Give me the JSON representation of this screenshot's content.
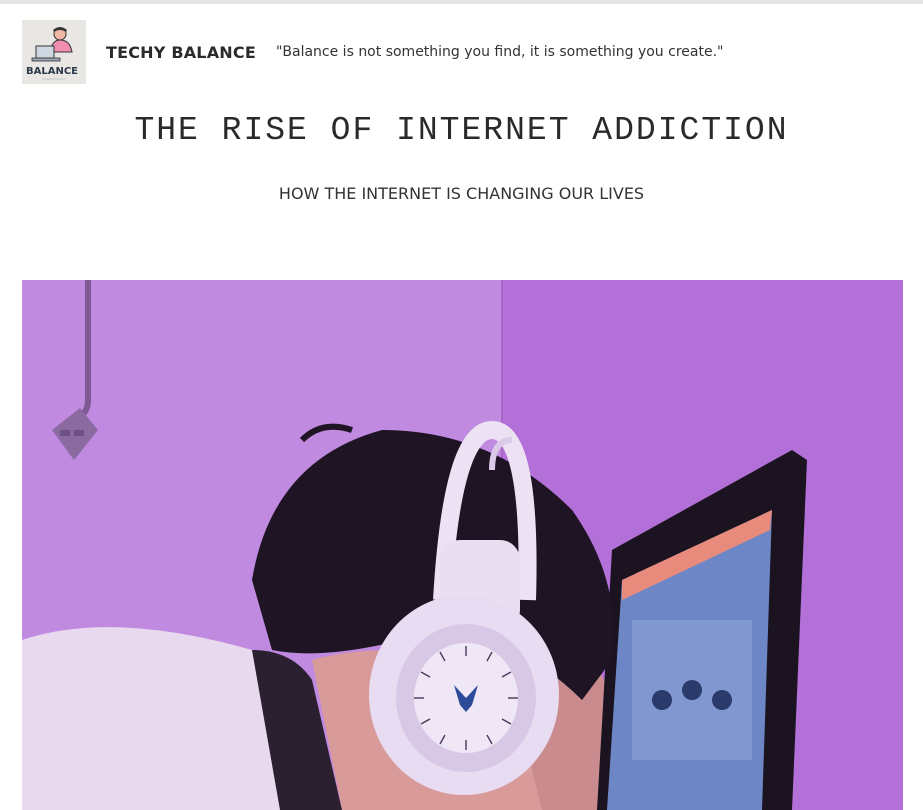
{
  "header": {
    "logo_text": "BALANCE",
    "brand": "TECHY BALANCE",
    "tagline": "\"Balance is not something you find, it is something you create.\""
  },
  "article": {
    "title": "THE RISE OF INTERNET ADDICTION",
    "subtitle": "HOW THE INTERNET IS CHANGING OUR LIVES"
  },
  "colors": {
    "wall": "#b97ad9",
    "headphones": "#e7dcf1",
    "hair": "#1f1424",
    "monitor": "#1b1420",
    "screen": "#6e86c4"
  }
}
